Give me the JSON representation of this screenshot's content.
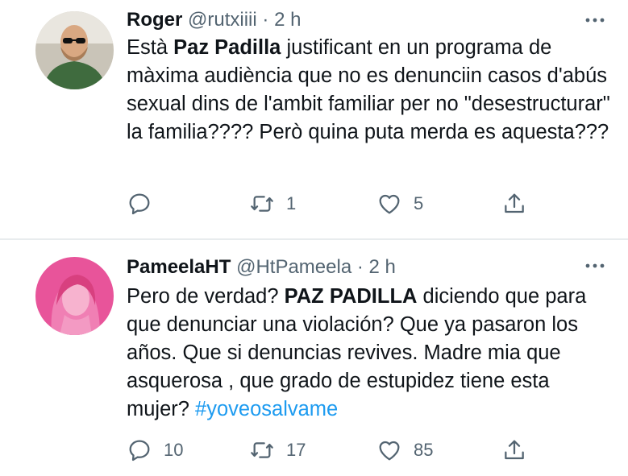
{
  "tweets": [
    {
      "name": "Roger",
      "handle": "@rutxiiii",
      "separator": "·",
      "time": "2 h",
      "text_1": "Està ",
      "text_bold": "Paz Padilla",
      "text_2": " justificant en un programa de màxima audiència que no es denunciin casos d'abús sexual dins de l'ambit familiar per no \"desestructurar\" la familia???? Però quina puta merda es aquesta???",
      "counts": {
        "reply": "",
        "retweet": "1",
        "like": "5"
      }
    },
    {
      "name": "PameelaHT",
      "handle": "@HtPameela",
      "separator": "·",
      "time": "2 h",
      "text_1": "Pero de verdad? ",
      "text_bold": "PAZ PADILLA",
      "text_2": " diciendo que para que denunciar una violación? Que ya pasaron los años. Que si denuncias revives. Madre mia que asquerosa , que grado de estupidez tiene esta mujer? ",
      "hashtag": "#yoveosalvame",
      "counts": {
        "reply": "10",
        "retweet": "17",
        "like": "85"
      }
    }
  ],
  "colors": {
    "text": "#0f1419",
    "secondary": "#536471",
    "link": "#1d9bf0",
    "divider": "#e8ecee"
  },
  "icons": [
    "more-icon",
    "reply-icon",
    "retweet-icon",
    "like-icon",
    "share-icon"
  ]
}
